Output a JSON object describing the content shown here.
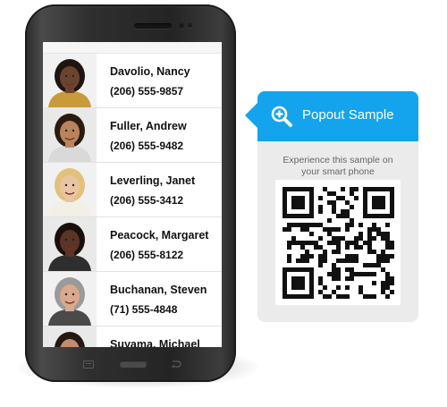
{
  "employees": [
    {
      "name": "Davolio, Nancy",
      "phone": "(206) 555-9857",
      "avatar": "woman-dark-curly-hair",
      "skin": "#6b4430",
      "hair": "#1e1410",
      "shirt": "#c99a3a"
    },
    {
      "name": "Fuller, Andrew",
      "phone": "(206) 555-9482",
      "avatar": "man-sunglasses",
      "skin": "#b9845c",
      "hair": "#2a1c12",
      "shirt": "#d9d9d9"
    },
    {
      "name": "Leverling, Janet",
      "phone": "(206) 555-3412",
      "avatar": "woman-blonde-short-hair",
      "skin": "#e8c4a4",
      "hair": "#e2c27a",
      "shirt": "#f2efe6"
    },
    {
      "name": "Peacock, Margaret",
      "phone": "(206) 555-8122",
      "avatar": "woman-dark-curly-hair",
      "skin": "#5a3424",
      "hair": "#1a100b",
      "shirt": "#2e2e2e"
    },
    {
      "name": "Buchanan, Steven",
      "phone": "(71) 555-4848",
      "avatar": "man-gray-hair",
      "skin": "#d8a98c",
      "hair": "#9a9a9a",
      "shirt": "#4a4a4a"
    },
    {
      "name": "Suyama, Michael",
      "phone": "",
      "avatar": "man-dark-hair",
      "skin": "#c48c6a",
      "hair": "#241813",
      "shirt": "#5a6d8a"
    }
  ],
  "popout": {
    "title": "Popout Sample",
    "description_line1": "Experience this sample on",
    "description_line2": "your smart phone",
    "icon": "zoom-in-icon",
    "accent": "#14a4ee",
    "qr_icon": "qr-code"
  },
  "phone_nav": {
    "back": "back-icon",
    "home": "home-button",
    "menu": "menu-icon"
  }
}
